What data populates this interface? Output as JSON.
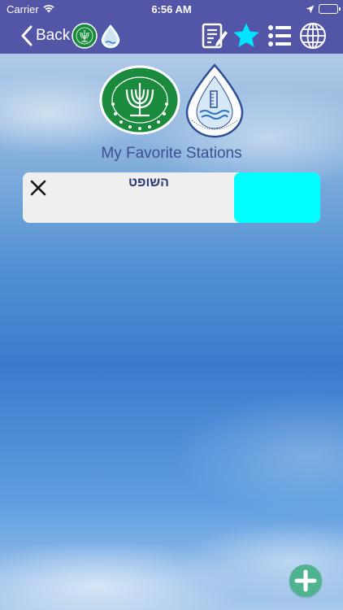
{
  "status": {
    "carrier": "Carrier",
    "time": "6:56 AM"
  },
  "nav": {
    "back_label": "Back"
  },
  "page": {
    "title": "My Favorite Stations"
  },
  "stations": [
    {
      "name": "השופט",
      "color": "#00ffff"
    }
  ],
  "colors": {
    "nav_bar": "#5355a6",
    "accent_star": "#00e5ff",
    "add_button": "#4fb38f",
    "title_text": "#3f4f92"
  },
  "icons": [
    "wifi-icon",
    "location-arrow-icon",
    "battery-icon",
    "chevron-left-icon",
    "ministry-agriculture-logo",
    "water-drop-logo",
    "edit-note-icon",
    "star-icon",
    "list-icon",
    "globe-icon",
    "close-icon",
    "plus-icon"
  ]
}
